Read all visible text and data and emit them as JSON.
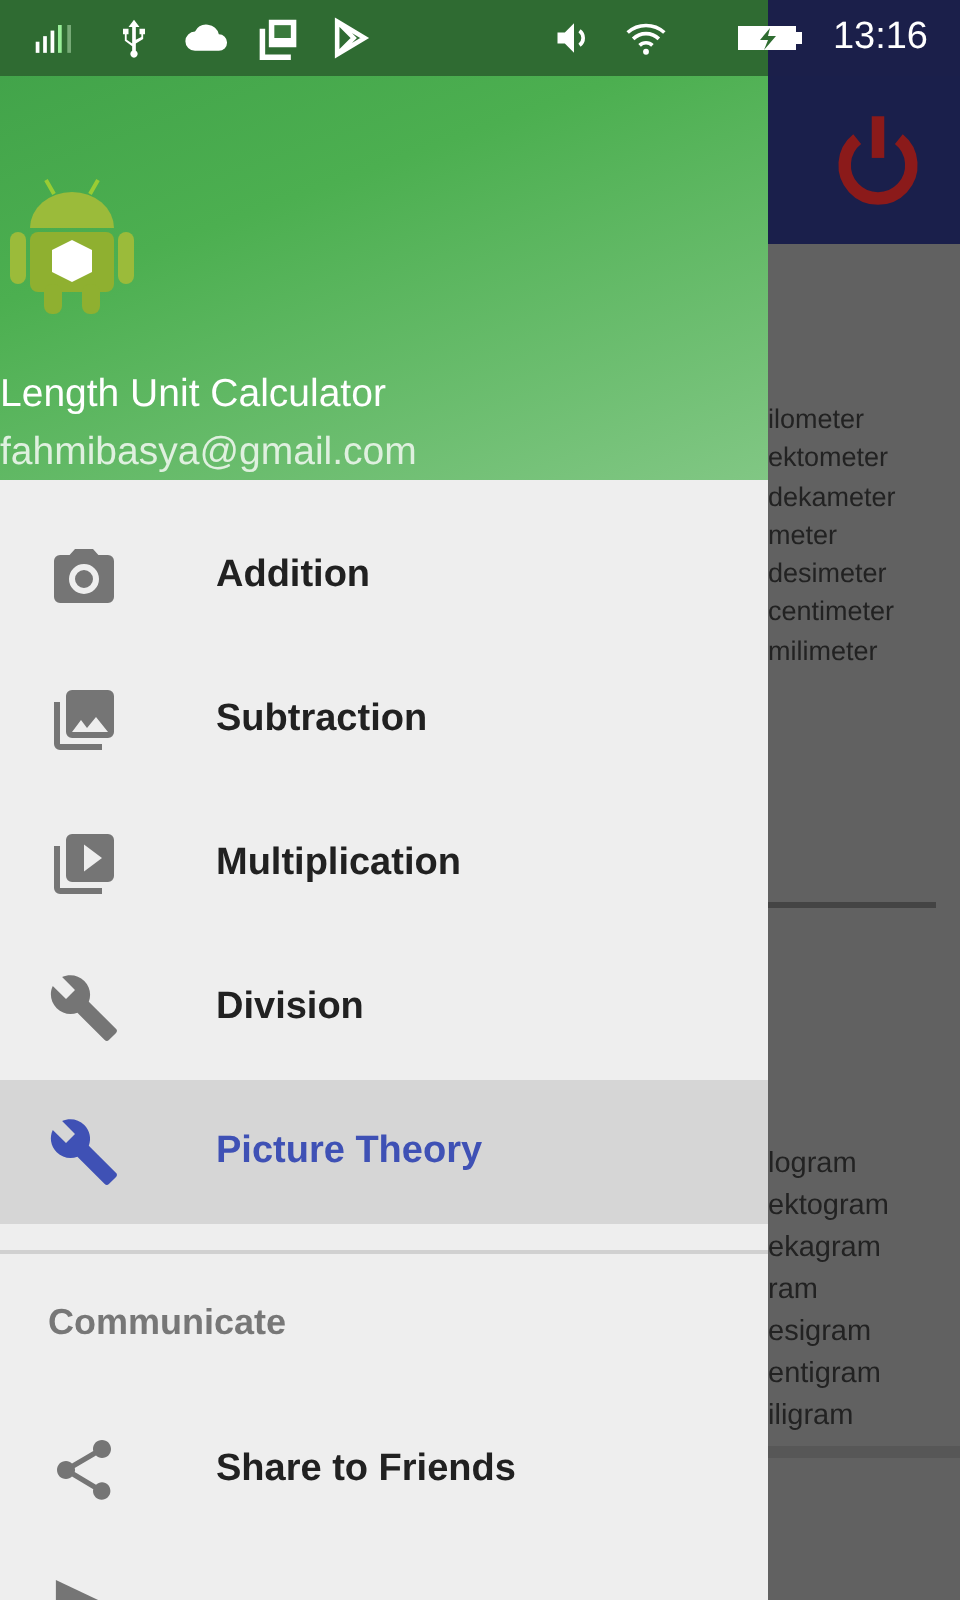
{
  "status_bar": {
    "time": "13:16"
  },
  "drawer": {
    "app_name": "Length Unit Calculator",
    "email": "fahmibasya@gmail.com",
    "items": [
      {
        "label": "Addition",
        "kind": "camera",
        "selected": false
      },
      {
        "label": "Subtraction",
        "kind": "image",
        "selected": false
      },
      {
        "label": "Multiplication",
        "kind": "video",
        "selected": false
      },
      {
        "label": "Division",
        "kind": "wrench",
        "selected": false
      },
      {
        "label": "Picture Theory",
        "kind": "wrench",
        "selected": true
      }
    ],
    "section_title": "Communicate",
    "section_items": [
      {
        "label": "Share to Friends",
        "kind": "share"
      },
      {
        "kind": "send"
      }
    ]
  },
  "background": {
    "length_units": [
      "ilometer",
      "ektometer",
      "dekameter",
      "meter",
      "desimeter",
      "centimeter",
      "milimeter"
    ],
    "mass_units": [
      "logram",
      "ektogram",
      "ekagram",
      "ram",
      "esigram",
      "entigram",
      "iligram"
    ]
  }
}
